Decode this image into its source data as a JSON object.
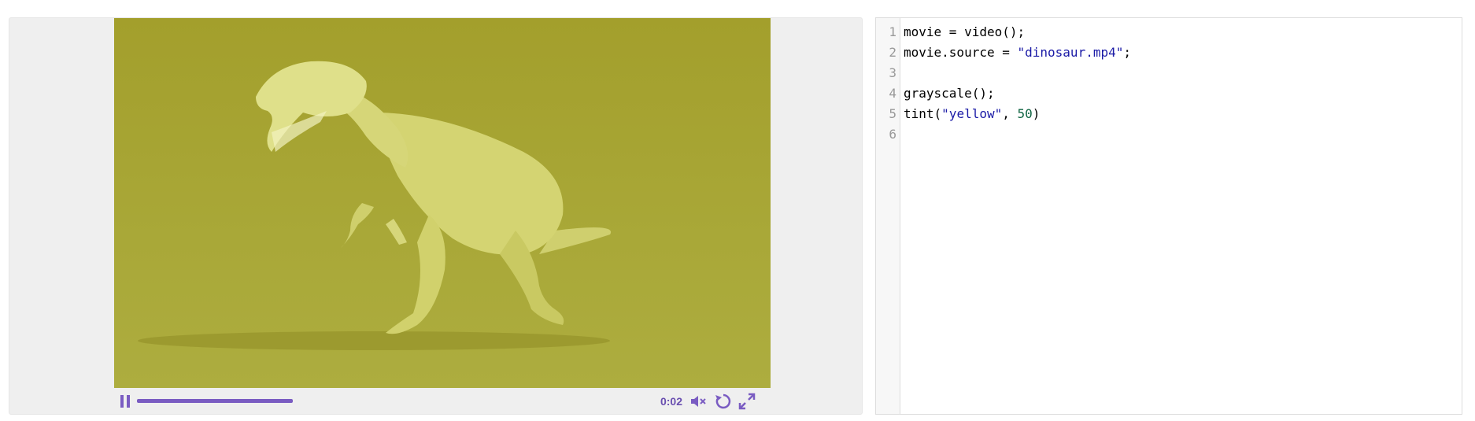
{
  "player": {
    "time_label": "0:02",
    "progress": 0.38,
    "accent_color": "#7a5cc2",
    "tint_color": "#a9a838",
    "icons": {
      "pause": "pause-icon",
      "mute": "mute-icon",
      "replay": "replay-icon",
      "fullscreen": "fullscreen-icon"
    }
  },
  "editor": {
    "lines": [
      {
        "num": "1",
        "parts": [
          {
            "t": "movie = video();",
            "c": "plain"
          }
        ]
      },
      {
        "num": "2",
        "parts": [
          {
            "t": "movie.source = ",
            "c": "plain"
          },
          {
            "t": "\"dinosaur.mp4\"",
            "c": "str"
          },
          {
            "t": ";",
            "c": "plain"
          }
        ]
      },
      {
        "num": "3",
        "parts": []
      },
      {
        "num": "4",
        "parts": [
          {
            "t": "grayscale();",
            "c": "plain"
          }
        ]
      },
      {
        "num": "5",
        "parts": [
          {
            "t": "tint(",
            "c": "plain"
          },
          {
            "t": "\"yellow\"",
            "c": "str"
          },
          {
            "t": ", ",
            "c": "plain"
          },
          {
            "t": "50",
            "c": "num"
          },
          {
            "t": ")",
            "c": "plain"
          }
        ]
      },
      {
        "num": "6",
        "parts": []
      }
    ]
  }
}
